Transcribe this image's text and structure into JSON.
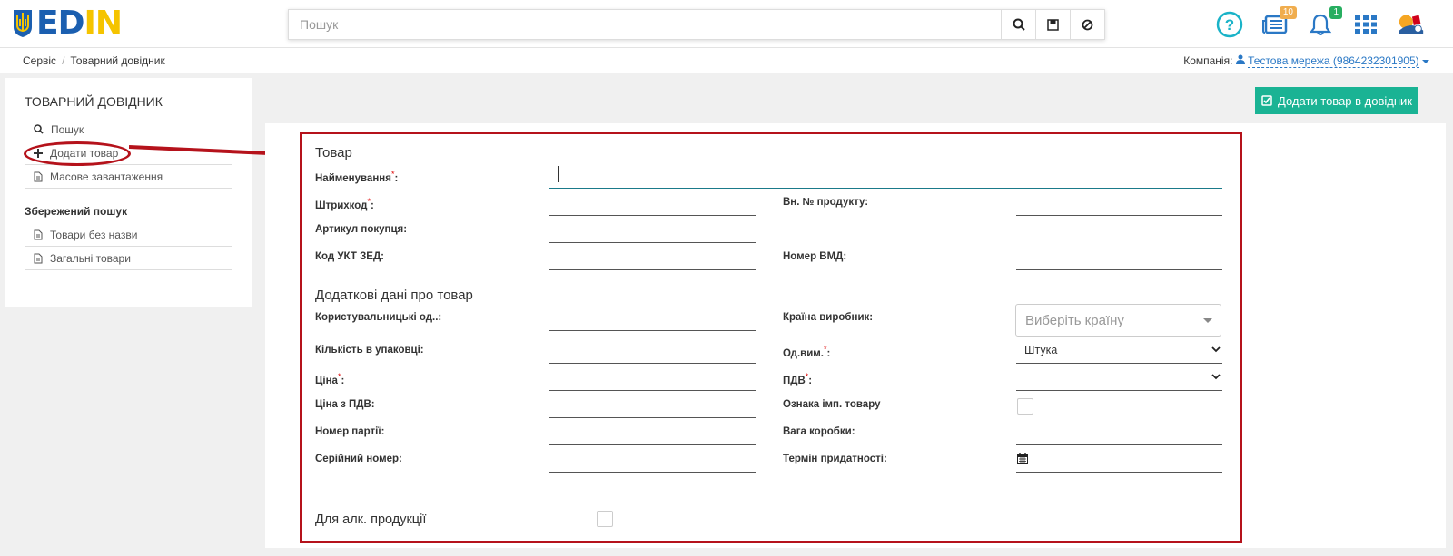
{
  "header": {
    "logo_text": "EDIN",
    "search_placeholder": "Пошук",
    "news_badge": "10",
    "notif_badge": "1"
  },
  "breadcrumb": {
    "items": [
      "Сервіс",
      "Товарний довідник"
    ],
    "company_label": "Компанія:",
    "company_value": "Тестова мережа (9864232301905)"
  },
  "sidebar": {
    "title": "ТОВАРНИЙ ДОВІДНИК",
    "items": [
      {
        "label": "Пошук",
        "icon": "search-icon"
      },
      {
        "label": "Додати товар",
        "icon": "plus-icon"
      },
      {
        "label": "Масове завантаження",
        "icon": "file-icon"
      }
    ],
    "saved_title": "Збережений пошук",
    "saved_items": [
      {
        "label": "Товари без назви",
        "icon": "file-icon"
      },
      {
        "label": "Загальні товари",
        "icon": "file-icon"
      }
    ]
  },
  "main": {
    "add_button": "Додати товар в довідник",
    "section1": "Товар",
    "section2": "Додаткові дані про товар",
    "fields": {
      "name": "Найменування",
      "barcode": "Штрихкод",
      "internal_no": "Вн. № продукту:",
      "article": "Артикул покупця:",
      "ukt": "Код УКТ ЗЕД:",
      "vmd": "Номер ВМД:",
      "user_units": "Користувальницькі од..:",
      "country": "Країна виробник:",
      "pack_qty": "Кількість в упаковці:",
      "unit": "Од.вим.",
      "price": "Ціна",
      "vat": "ПДВ",
      "price_vat": "Ціна з ПДВ:",
      "import_flag": "Ознака імп. товару",
      "batch": "Номер партії:",
      "box_weight": "Вага коробки:",
      "serial": "Серійний номер:",
      "expiry": "Термін придатності:",
      "alcohol": "Для алк. продукції"
    },
    "country_placeholder": "Виберіть країну",
    "unit_value": "Штука",
    "required_mark": "*",
    "colon": ":"
  }
}
